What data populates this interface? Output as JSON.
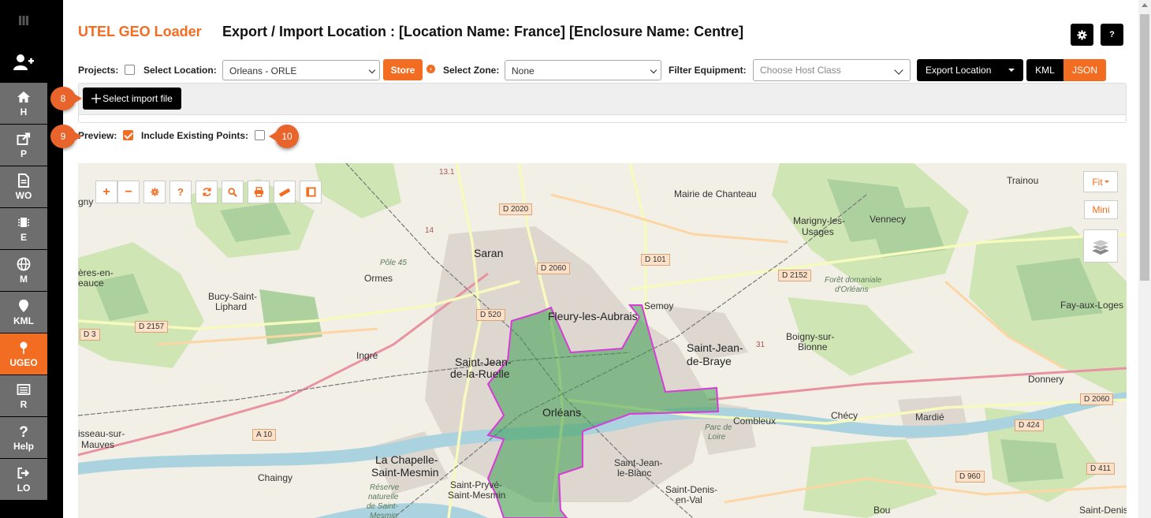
{
  "sidebar": {
    "items": [
      {
        "label": "H",
        "icon": "home-icon"
      },
      {
        "label": "P",
        "icon": "share-icon"
      },
      {
        "label": "WO",
        "icon": "document-icon"
      },
      {
        "label": "E",
        "icon": "chip-icon"
      },
      {
        "label": "M",
        "icon": "globe-icon"
      },
      {
        "label": "KML",
        "icon": "map-pin-icon"
      },
      {
        "label": "UGEO",
        "icon": "map-pin-icon"
      },
      {
        "label": "R",
        "icon": "list-icon"
      },
      {
        "label": "Help",
        "icon": "question-icon"
      },
      {
        "label": "LO",
        "icon": "logout-icon"
      }
    ],
    "active": "UGEO",
    "accent": "#f26d21"
  },
  "header": {
    "brand": "UTEL GEO Loader",
    "title": "Export / Import Location : [Location Name: France] [Enclosure Name: Centre]",
    "settings_icon": "gear-icon",
    "help_label": "?"
  },
  "toolbar": {
    "projects_label": "Projects:",
    "select_location_label": "Select Location:",
    "location_value": "Orleans - ORLE",
    "store_label": "Store",
    "select_zone_label": "Select Zone:",
    "zone_value": "None",
    "filter_equipment_label": "Filter Equipment:",
    "filter_placeholder": "Choose Host Class",
    "export_label": "Export Location",
    "kml_label": "KML",
    "json_label": "JSON"
  },
  "import": {
    "select_file_label": "Select import file"
  },
  "options": {
    "preview_label": "Preview:",
    "preview_checked": true,
    "include_existing_label": "Include Existing Points:",
    "include_existing_checked": false
  },
  "callouts": {
    "c8": "8",
    "c9": "9",
    "c10": "10"
  },
  "map": {
    "fit_label": "Fit",
    "mini_label": "Mini",
    "places": {
      "saran": "Saran",
      "fleury": "Fleury-les-Aubrais",
      "semoy": "Semoy",
      "mairie": "Mairie de Chanteau",
      "marigny1": "Marigny-les-",
      "marigny2": "Usages",
      "vennecy": "Vennecy",
      "trainou": "Trainou",
      "ormes": "Ormes",
      "pole45": "Pôle 45",
      "bucy1": "Bucy-Saint-",
      "bucy2": "Liphard",
      "ingre": "Ingré",
      "sjr1": "Saint-Jean-",
      "sjr2": "de-la-Ruelle",
      "orleans": "Orléans",
      "sjb1": "Saint-Jean-",
      "sjb2": "de-Braye",
      "boigny1": "Boigny-sur-",
      "boigny2": "Bionne",
      "foret1": "Forêt domaniale",
      "foret2": "d'Orléans",
      "fay": "Fay-aux-Loges",
      "donnery": "Donnery",
      "combleux": "Combleux",
      "checy": "Chécy",
      "mardie": "Mardié",
      "parc1": "Parc de",
      "parc2": "Loire",
      "lachapelle1": "La Chapelle-",
      "lachapelle2": "Saint-Mesmin",
      "chaingy": "Chaingy",
      "sp1": "Saint-Pryvé-",
      "sp2": "Saint-Mesmin",
      "reserve1": "Réserve",
      "reserve2": "naturelle",
      "reserve3": "de Saint-",
      "reserve4": "Mesmin",
      "sjlb1": "Saint-Jean-",
      "sjlb2": "le-Blanc",
      "sdv1": "Saint-Denis-",
      "sdv2": "en-Val",
      "bou": "Bou",
      "sdh": "Saint-Denis-",
      "eres1": "ères-en-",
      "eres2": "eauce",
      "gny": "gny",
      "isseau1": "isseau-sur-",
      "isseau2": "Mauves"
    },
    "roads": {
      "d2020": "D 2020",
      "d2060": "D 2060",
      "d101": "D 101",
      "d2152": "D 2152",
      "d520": "D 520",
      "d2157": "D 2157",
      "d3": "D 3",
      "a10": "A 10",
      "d2060e": "D 2060",
      "d424": "D 424",
      "d960": "D 960",
      "d411": "D 411",
      "r131": "13.1",
      "r14": "14",
      "r31": "31"
    }
  }
}
